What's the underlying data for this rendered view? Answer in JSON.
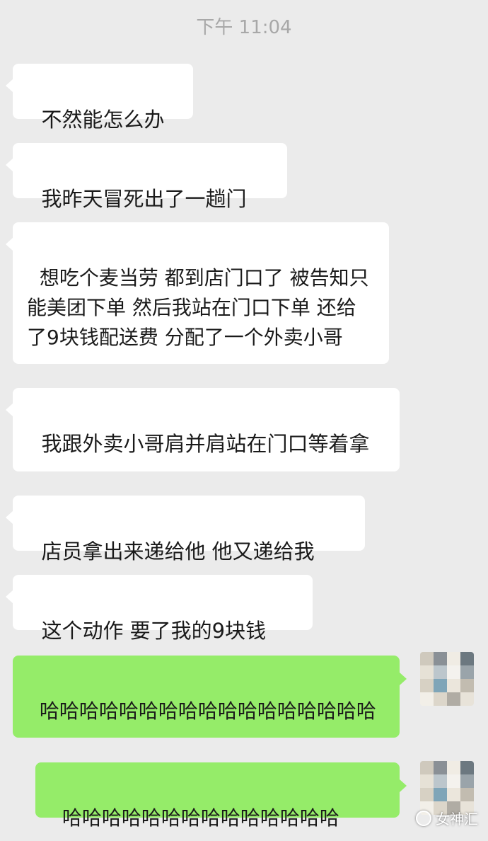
{
  "chat": {
    "timestamp": "下午 11:04",
    "messages": [
      {
        "side": "incoming",
        "text": "不然能怎么办"
      },
      {
        "side": "incoming",
        "text": "我昨天冒死出了一趟门"
      },
      {
        "side": "incoming",
        "text": "想吃个麦当劳 都到店门口了 被告知只能美团下单 然后我站在门口下单 还给了9块钱配送费 分配了一个外卖小哥"
      },
      {
        "side": "incoming",
        "text": "我跟外卖小哥肩并肩站在门口等着拿"
      },
      {
        "side": "incoming",
        "text": "店员拿出来递给他 他又递给我"
      },
      {
        "side": "incoming",
        "text": "这个动作 要了我的9块钱"
      },
      {
        "side": "outgoing",
        "text": "哈哈哈哈哈哈哈哈哈哈哈哈哈哈哈哈哈"
      },
      {
        "side": "outgoing",
        "text": "哈哈哈哈哈哈哈哈哈哈哈哈哈哈"
      }
    ]
  },
  "watermark": {
    "text": "女神汇",
    "icon": "wechat-official-account-icon"
  },
  "colors": {
    "background": "#ebebeb",
    "incoming_bubble": "#ffffff",
    "outgoing_bubble": "#95ec69",
    "timestamp": "#a8a8a8"
  }
}
